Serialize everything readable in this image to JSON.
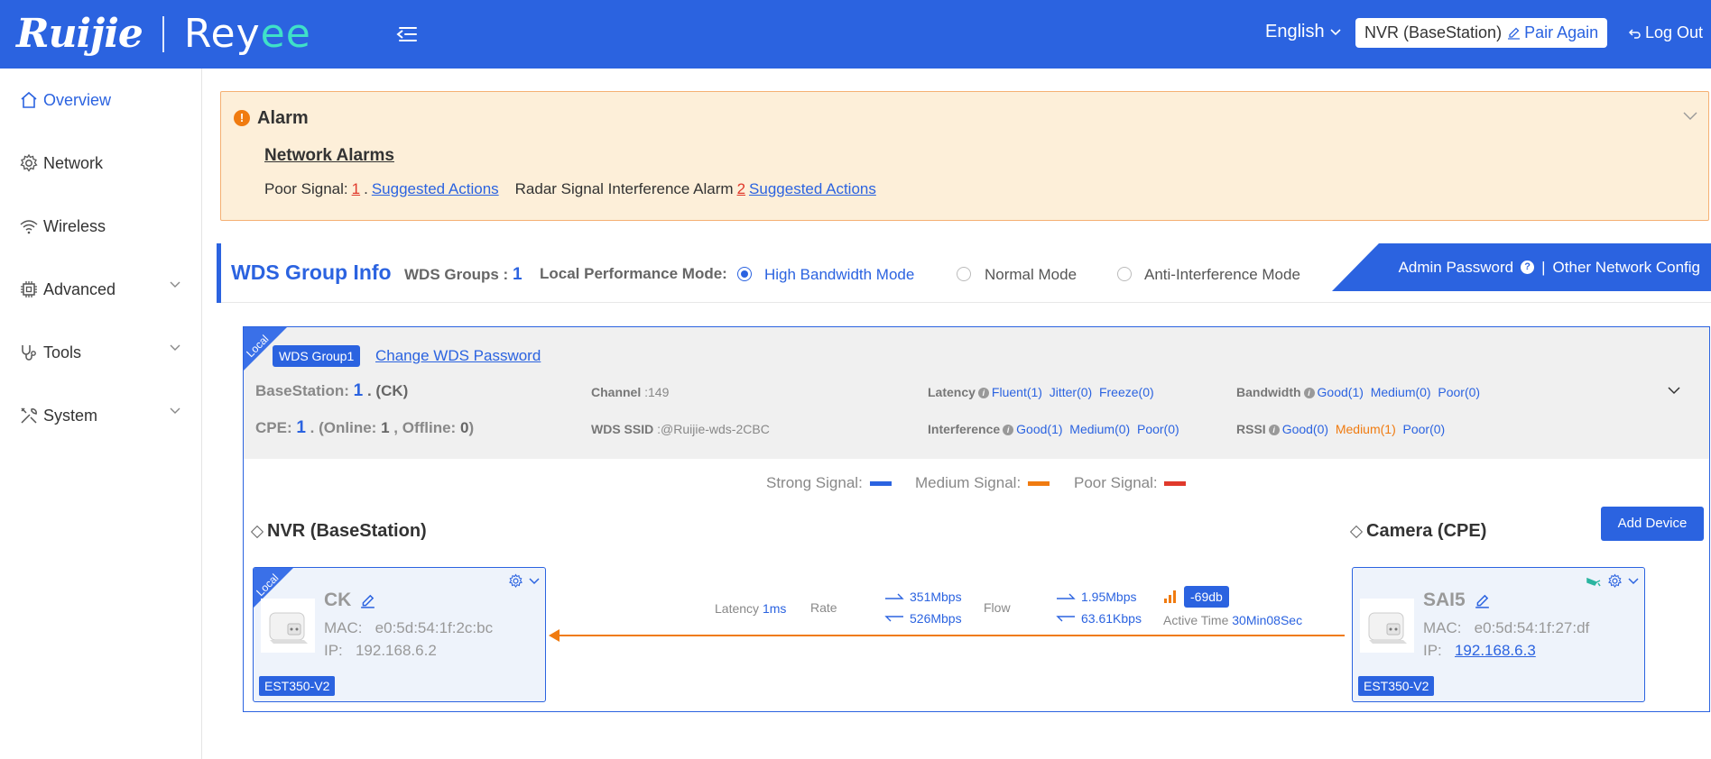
{
  "header": {
    "brand_left": "Ruijie",
    "brand_right_a": "R",
    "brand_right_b": "ey",
    "brand_right_c": "ee",
    "language": "English",
    "device": "NVR (BaseStation)",
    "pair_again": "Pair Again",
    "logout": "Log Out"
  },
  "sidebar": {
    "items": [
      {
        "label": "Overview",
        "icon": "home-icon",
        "active": true
      },
      {
        "label": "Network",
        "icon": "gear-icon"
      },
      {
        "label": "Wireless",
        "icon": "wifi-icon"
      },
      {
        "label": "Advanced",
        "icon": "chip-icon",
        "expandable": true
      },
      {
        "label": "Tools",
        "icon": "stethoscope-icon",
        "expandable": true
      },
      {
        "label": "System",
        "icon": "wrench-icon",
        "expandable": true
      }
    ]
  },
  "alarm": {
    "title": "Alarm",
    "subtitle": "Network Alarms",
    "poor_signal_label": "Poor Signal:",
    "poor_signal_count": "1",
    "poor_signal_sep": ".",
    "suggested_actions_1": "Suggested Actions",
    "radar_label": "Radar Signal Interference Alarm",
    "radar_count": "2",
    "suggested_actions_2": "Suggested Actions"
  },
  "wds": {
    "title": "WDS Group Info",
    "groups_label": "WDS Groups :",
    "groups_count": "1",
    "mode_label": "Local Performance Mode:",
    "modes": [
      "High Bandwidth Mode",
      "Normal Mode",
      "Anti-Interference Mode"
    ],
    "selected_mode": "High Bandwidth Mode",
    "admin_password": "Admin Password",
    "divider": "|",
    "other_config": "Other Network Config"
  },
  "group": {
    "local_tag": "Local",
    "name": "WDS Group1",
    "change_password": "Change WDS Password",
    "basestation_label": "BaseStation:",
    "basestation_count": "1",
    "basestation_name": ". (CK)",
    "cpe_label": "CPE:",
    "cpe_count": "1",
    "cpe_online_label": ". (Online:",
    "cpe_online": "1",
    "cpe_offline_label": ", Offline:",
    "cpe_offline": "0",
    "cpe_close": ")",
    "channel_label": "Channel",
    "channel_value": ":149",
    "ssid_label": "WDS SSID",
    "ssid_value": ":@Ruijie-wds-2CBC",
    "latency_label": "Latency",
    "latency_vals": [
      "Fluent(1)",
      "Jitter(0)",
      "Freeze(0)"
    ],
    "interference_label": "Interference",
    "interference_vals": [
      "Good(1)",
      "Medium(0)",
      "Poor(0)"
    ],
    "bandwidth_label": "Bandwidth",
    "bandwidth_vals": [
      "Good(1)",
      "Medium(0)",
      "Poor(0)"
    ],
    "rssi_label": "RSSI",
    "rssi_vals": [
      "Good(0)",
      "Medium(1)",
      "Poor(0)"
    ]
  },
  "legend": {
    "strong": "Strong Signal:",
    "medium": "Medium Signal:",
    "poor": "Poor Signal:",
    "colors": {
      "strong": "#2b63e0",
      "medium": "#f07b10",
      "poor": "#e0392b"
    }
  },
  "topology": {
    "left_title": "NVR (BaseStation)",
    "right_title": "Camera (CPE)",
    "add_device": "Add Device",
    "base": {
      "local_tag": "Local",
      "name": "CK",
      "mac_label": "MAC:",
      "mac": "e0:5d:54:1f:2c:bc",
      "ip_label": "IP:",
      "ip": "192.168.6.2",
      "model": "EST350-V2"
    },
    "cpe": {
      "name": "SAI5",
      "mac_label": "MAC:",
      "mac": "e0:5d:54:1f:27:df",
      "ip_label": "IP:",
      "ip": "192.168.6.3",
      "model": "EST350-V2"
    },
    "link": {
      "latency_label": "Latency",
      "latency": "1ms",
      "rate_label": "Rate",
      "rate_up": "351Mbps",
      "rate_down": "526Mbps",
      "flow_label": "Flow",
      "flow_up": "1.95Mbps",
      "flow_down": "63.61Kbps",
      "rssi": "-69db",
      "active_time_label": "Active Time",
      "active_time": "30Min08Sec"
    }
  }
}
